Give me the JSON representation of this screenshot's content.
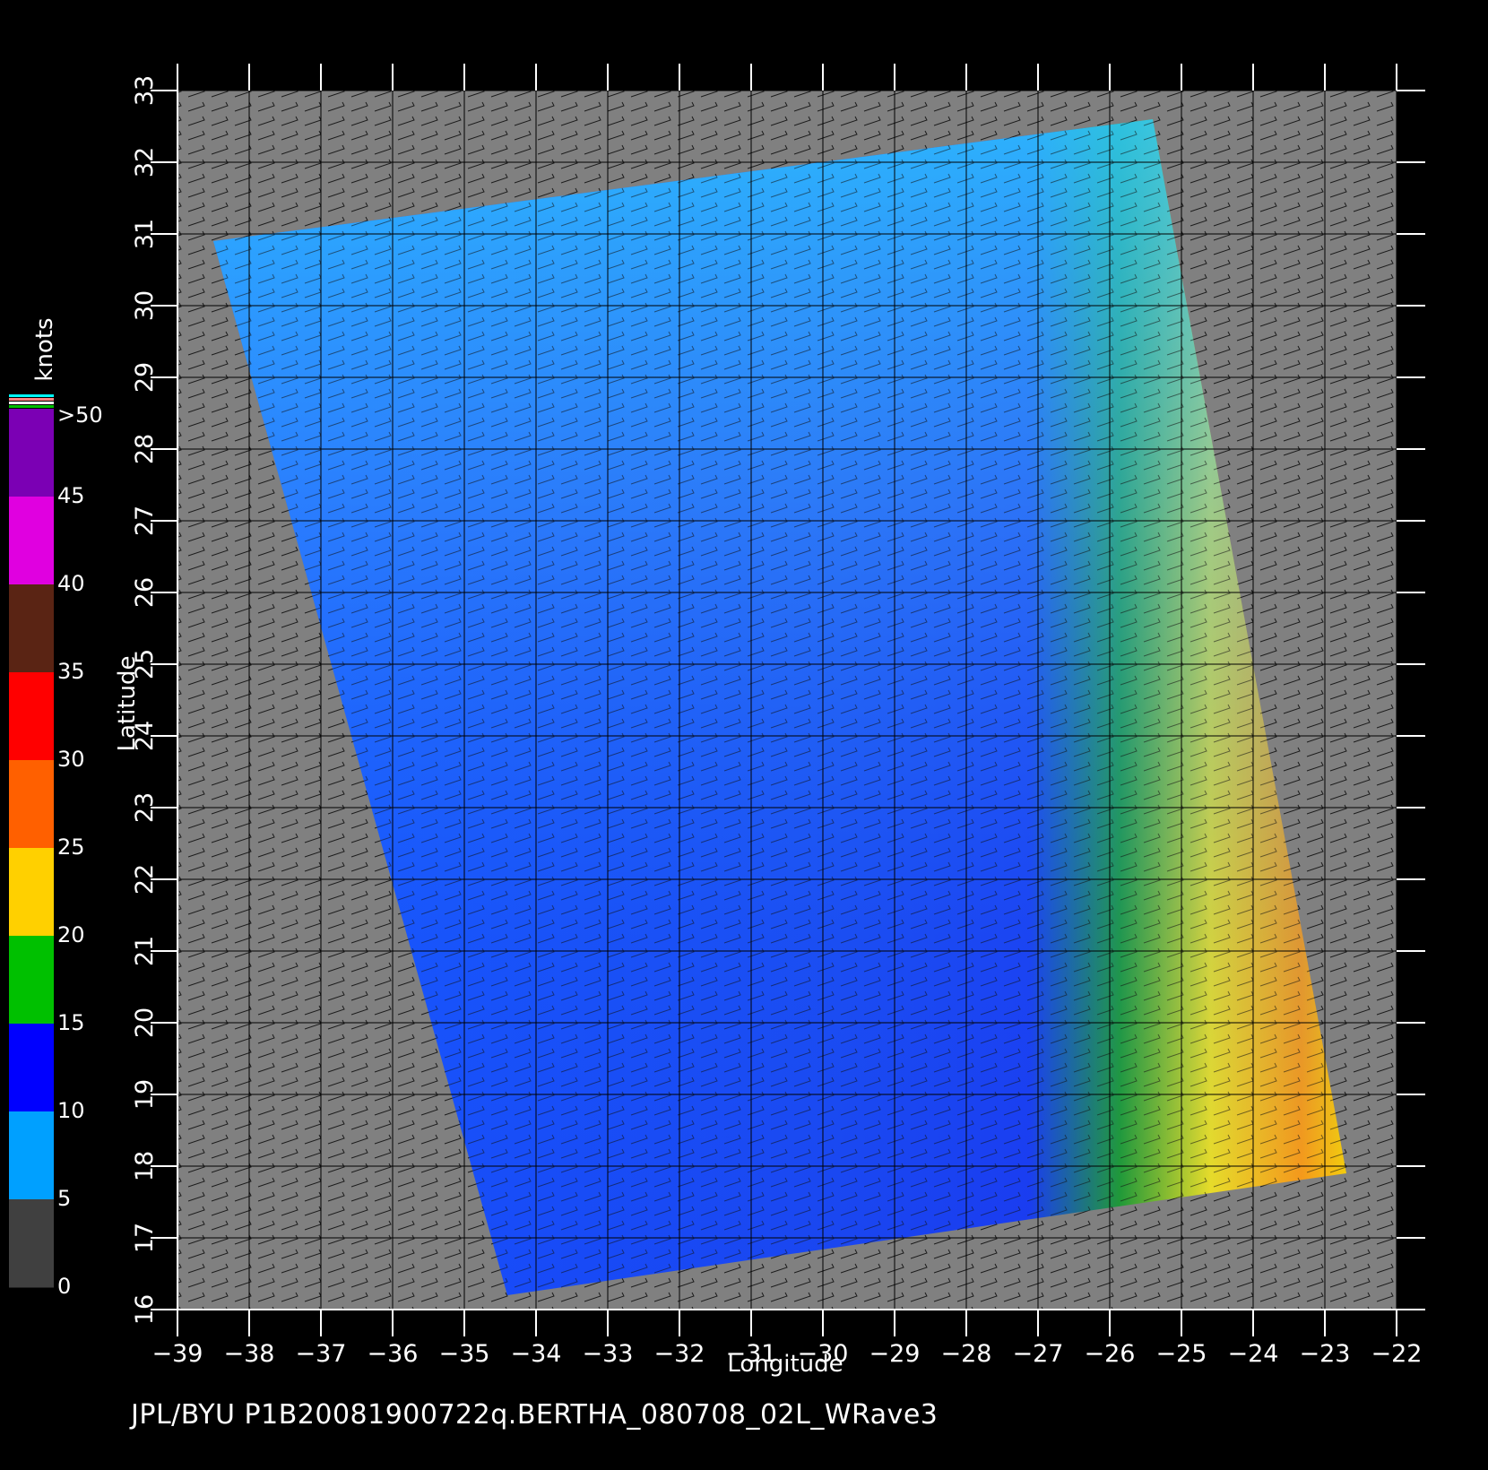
{
  "footer": "JPL/BYU  P1B20081900722q.BERTHA_080708_02L_WRave3",
  "map": {
    "xlabel": "Longitude",
    "ylabel": "Latitude",
    "lon_range": [
      -39,
      -22
    ],
    "lat_range": [
      16,
      33
    ],
    "lon_ticks": [
      "−39",
      "−38",
      "−37",
      "−36",
      "−35",
      "−34",
      "−33",
      "−32",
      "−31",
      "−30",
      "−29",
      "−28",
      "−27",
      "−26",
      "−25",
      "−24",
      "−23",
      "−22"
    ],
    "lat_ticks": [
      "16",
      "17",
      "18",
      "19",
      "20",
      "21",
      "22",
      "23",
      "24",
      "25",
      "26",
      "27",
      "28",
      "29",
      "30",
      "31",
      "32",
      "33"
    ],
    "grid": true,
    "background_color": "#808080",
    "swath_corners_lonlat": [
      [
        -38.5,
        30.9
      ],
      [
        -25.4,
        32.6
      ],
      [
        -22.7,
        17.9
      ],
      [
        -34.4,
        16.2
      ]
    ]
  },
  "colorbar": {
    "unit": "knots",
    "labels": [
      ">50",
      "45",
      "40",
      "35",
      "30",
      "25",
      "20",
      "15",
      "10",
      "5",
      "0"
    ],
    "colors": [
      "#7b00b4",
      "#e000e0",
      "#5a2414",
      "#ff0000",
      "#ff6000",
      "#ffd000",
      "#00c000",
      "#0000ff",
      "#00a0ff",
      "#404040"
    ]
  }
}
